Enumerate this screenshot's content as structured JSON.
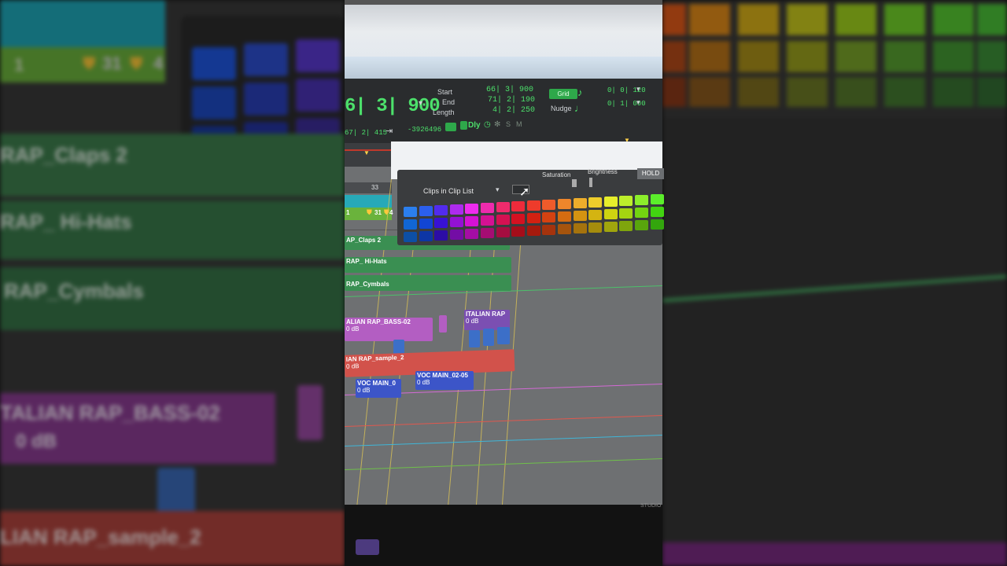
{
  "counter": {
    "main_counter": "6| 3| 900",
    "sub_counter": "67| 2| 415",
    "sample_value": "-3926496",
    "start_label": "Start",
    "end_label": "End",
    "length_label": "Length",
    "start_value": "66| 3| 900",
    "end_value": "71| 2| 190",
    "length_value": "4| 2| 250",
    "grid_label": "Grid",
    "nudge_label": "Nudge",
    "grid_value": "0| 0| 120",
    "nudge_value": "0| 1| 000",
    "dly_label": "Dly",
    "s_label": "S",
    "m_label": "M"
  },
  "timeline": {
    "bar_number": "33"
  },
  "clips": {
    "claps": "AP_Claps 2",
    "hihats": "RAP_ Hi-Hats",
    "cymbals": "RAP_Cymbals",
    "bass": "ALIAN RAP_BASS-02",
    "bass_gain": "0 dB",
    "italian_rap": "ITALIAN RAP",
    "italian_gain": "0 dB",
    "sample2": "IAN RAP_sample_2",
    "sample2_gain": "0 dB",
    "voc_main_0": "VOC MAIN_0",
    "voc_main_0_gain": "0 dB",
    "voc_main_02": "VOC MAIN_02-05",
    "voc_main_02_gain": "0 dB",
    "track_number_1": "1",
    "track_number_31": "31",
    "track_number_4": "4"
  },
  "popup": {
    "dropdown_label": "Clips in Clip List",
    "saturation_label": "Saturation",
    "brightness_label": "Brightness",
    "hold_label": "HOLD"
  },
  "left_zoom": {
    "claps": "RAP_Claps 2",
    "hihats": "RAP_ Hi-Hats",
    "cymbals": "RAP_Cymbals",
    "bass": "TALIAN RAP_BASS-02",
    "bass_gain": "0 dB",
    "sample2": "LIAN RAP_sample_2",
    "track_number_1": "1",
    "track_number_31": "31",
    "track_number_4": "4"
  },
  "bottom": {
    "studio_label": "STUDIO"
  },
  "colors": {
    "accent_green": "#4ce06b",
    "clip_green": "#3a8f52",
    "clip_purple": "#b35ec2",
    "clip_red": "#d2524b",
    "clip_blue": "#3c55c8"
  }
}
